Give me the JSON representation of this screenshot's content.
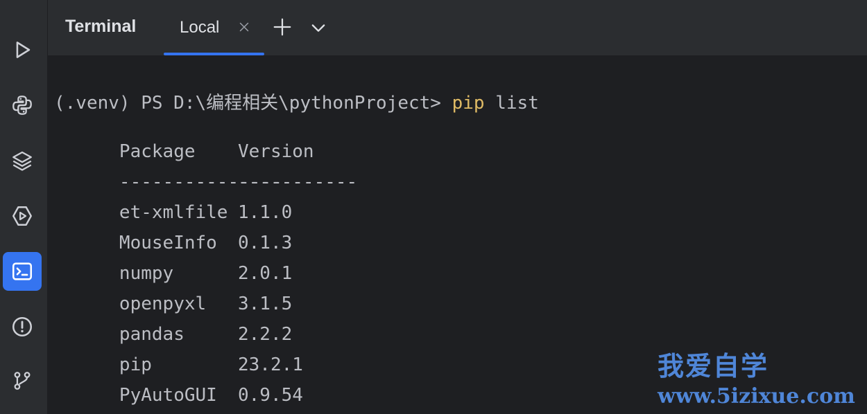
{
  "colors": {
    "accent": "#3574f0",
    "command_keyword": "#e0bb65",
    "watermark": "#4f86d8"
  },
  "toolstrip": {
    "items": [
      {
        "icon": "run-icon",
        "active": false
      },
      {
        "icon": "python-console-icon",
        "active": false
      },
      {
        "icon": "layers-icon",
        "active": false
      },
      {
        "icon": "services-icon",
        "active": false
      },
      {
        "icon": "terminal-icon",
        "active": true
      },
      {
        "icon": "problems-icon",
        "active": false
      },
      {
        "icon": "git-icon",
        "active": false
      }
    ]
  },
  "header": {
    "title": "Terminal",
    "tabs": [
      {
        "label": "Local",
        "active": true,
        "close_icon": "close-icon"
      }
    ],
    "add_icon": "plus-icon",
    "dropdown_icon": "chevron-down-icon"
  },
  "terminal": {
    "prompt": "(.venv) PS D:\\编程相关\\pythonProject> ",
    "command_keyword": "pip",
    "command_rest": " list",
    "headers": [
      "Package",
      "Version"
    ],
    "separator": [
      "---------------",
      "-----------"
    ],
    "rows": [
      {
        "package": "et-xmlfile",
        "version": "1.1.0"
      },
      {
        "package": "MouseInfo",
        "version": "0.1.3"
      },
      {
        "package": "numpy",
        "version": "2.0.1"
      },
      {
        "package": "openpyxl",
        "version": "3.1.5"
      },
      {
        "package": "pandas",
        "version": "2.2.2"
      },
      {
        "package": "pip",
        "version": "23.2.1"
      },
      {
        "package": "PyAutoGUI",
        "version": "0.9.54"
      }
    ]
  },
  "watermark": {
    "text": "我爱自学",
    "url": "www.5izixue.com"
  }
}
